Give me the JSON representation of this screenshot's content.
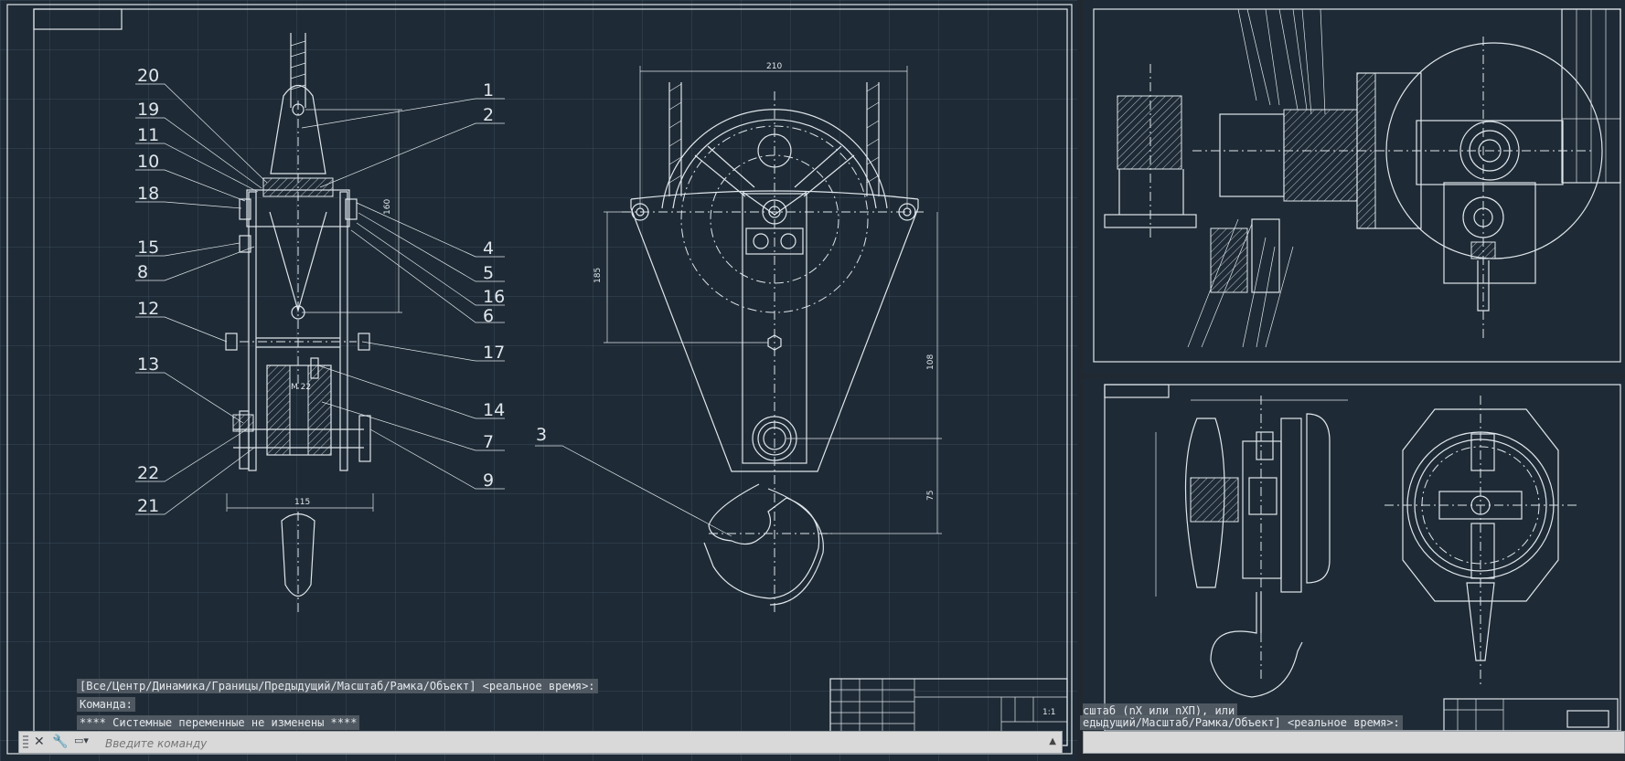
{
  "callouts": [
    "1",
    "2",
    "3",
    "4",
    "5",
    "6",
    "7",
    "8",
    "9",
    "10",
    "11",
    "12",
    "13",
    "14",
    "15",
    "16",
    "17",
    "18",
    "19",
    "20",
    "21",
    "22"
  ],
  "dimensions": {
    "width_top": "210",
    "shaft_span": "115",
    "left_height": "185",
    "right_height_upper": "108",
    "right_height_lower": "75",
    "vertical_height": "160",
    "thread": "M 22"
  },
  "command_history": {
    "line1": "[Все/Центр/Динамика/Границы/Предыдущий/Масштаб/Рамка/Объект] <реальное время>:",
    "line2": "Команда:",
    "line3": "**** Системные переменные не изменены ****"
  },
  "command_input": {
    "placeholder": "Введите команду"
  },
  "right_history": {
    "line1": "сштаб (nX или nXП), или",
    "line2": "едыдущий/Масштаб/Рамка/Объект] <реальное время>:"
  },
  "title_block": {
    "scale": "1:1"
  },
  "colors": {
    "background": "#1e2a35",
    "lines": "#dfe6ec",
    "command_bar": "#d9d9d9"
  },
  "icons": [
    "close-icon",
    "wrench-icon",
    "command-prompt-icon",
    "chevron-up-icon"
  ]
}
